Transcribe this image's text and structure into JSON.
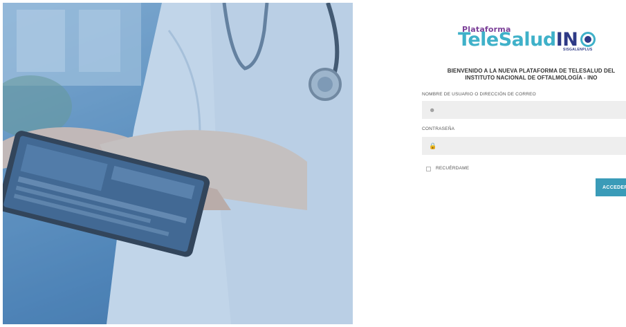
{
  "hero": {
    "image": "doctor-using-tablet-photo"
  },
  "logo": {
    "small": "Plataforma",
    "main_prefix": "TeleSalud",
    "main_suffix": "IN",
    "icon": "eye-logo-icon",
    "sub": "SISGALENPLUS"
  },
  "welcome": {
    "line1": "BIENVENIDO A LA NUEVA PLATAFORMA DE TELESALUD DEL",
    "line2": "INSTITUTO NACIONAL DE OFTALMOLOGÍA - INO"
  },
  "form": {
    "username_label": "NOMBRE DE USUARIO O DIRECCIÓN DE CORREO",
    "username_value": "",
    "username_icon": "user-icon",
    "password_label": "CONTRASEÑA",
    "password_value": "",
    "password_icon": "lock-icon",
    "remember_label": "RECUÉRDAME",
    "remember_checked": false,
    "submit_label": "ACCEDER"
  },
  "colors": {
    "brand_teal": "#3fb1c9",
    "brand_navy": "#2e3a86",
    "brand_purple": "#7b3f98",
    "button": "#3a9bb8",
    "field_bg": "#eeeeee"
  }
}
